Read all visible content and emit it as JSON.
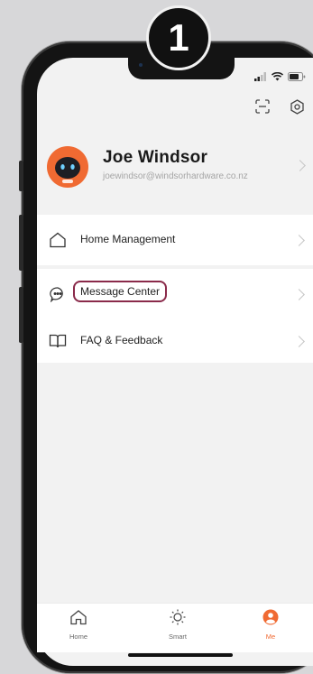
{
  "step_badge": "1",
  "profile": {
    "name": "Joe Windsor",
    "email": "joewindsor@windsorhardware.co.nz"
  },
  "menu_group1": [
    {
      "label": "Home Management",
      "icon": "home-outline-icon"
    }
  ],
  "menu_group2": [
    {
      "label": "Message Center",
      "icon": "chat-bubble-icon",
      "highlighted": true
    },
    {
      "label": "FAQ & Feedback",
      "icon": "book-icon"
    }
  ],
  "tabs": [
    {
      "label": "Home",
      "icon": "home-icon"
    },
    {
      "label": "Smart",
      "icon": "sun-icon"
    },
    {
      "label": "Me",
      "icon": "person-icon",
      "active": true
    }
  ],
  "colors": {
    "accent": "#f06a32",
    "highlight_border": "#8a2a4a"
  }
}
